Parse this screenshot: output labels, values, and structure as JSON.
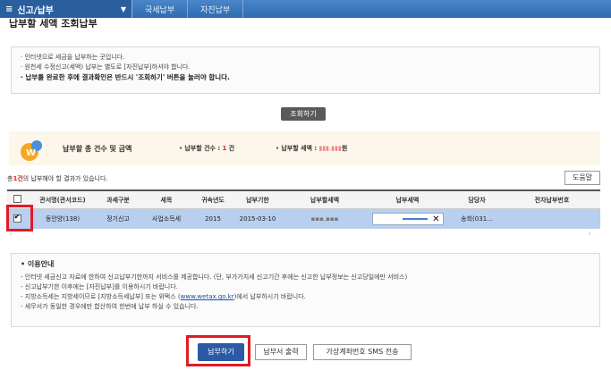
{
  "nav": {
    "menu_label": "신고/납부",
    "menu_icon": "menu-icon",
    "crumbs": [
      "국세납부",
      "자진납부"
    ]
  },
  "page": {
    "title": "납부할 세액 조회납부"
  },
  "notices": [
    "인터넷으로 세금을 납부하는 곳입니다.",
    "원천세 수정신고(세액) 납부는 별도로 [자진납부]하셔야 합니다.",
    "납부를 완료한 후에 결과확인은 반드시 '조회하기' 버튼을 눌러야 합니다."
  ],
  "query_button": "조회하기",
  "summary": {
    "title": "납부할 총 건수 및 금액",
    "count_label": "납부할 건수 :",
    "count_value": "1",
    "count_unit": "건",
    "amount_label": "납부할 세액 :",
    "amount_unit": "원"
  },
  "result": {
    "prefix": "총",
    "count": "1건",
    "suffix": "의 납부해야 할 결과가 있습니다."
  },
  "help_button": "도움말",
  "table": {
    "headers": [
      "관서명(관서코드)",
      "과세구분",
      "세목",
      "귀속년도",
      "납부기한",
      "납부할세액",
      "납부세액",
      "담당자",
      "전자납부번호"
    ],
    "rows": [
      {
        "checked": true,
        "office": "동안양(138)",
        "type": "정기신고",
        "tax": "사업소득세",
        "year": "2015",
        "due": "2015-03-10",
        "manager": "송희(031..."
      }
    ]
  },
  "info": {
    "title": "이용안내",
    "items": [
      "인터넷 세금신고 자료에 한하여 신고납부기한까지 서비스를 제공합니다. (단, 부가가치세 신고기간 후에는 신고한 납부정보는 신고당일에만 서비스)",
      "신고납부기한 이후에는 [자진납부]를 이용하시기 바랍니다.",
      "지방소득세는 지방세이므로 [지방소득세납부] 또는 위택스 (",
      "www.wetax.go.kr",
      ")에서 납부하시기 바랍니다.",
      "세무서가 동일한 경우에만 합산하여 한번에 납부 하실 수 있습니다."
    ]
  },
  "buttons": {
    "pay": "납부하기",
    "print": "납부서 출력",
    "sms": "가상계좌번호 SMS 전송"
  },
  "colors": {
    "nav": "#2f6bb0",
    "selected_row": "#b9cff0",
    "highlight": "#e01b24",
    "pay_button": "#2b5aa6"
  }
}
